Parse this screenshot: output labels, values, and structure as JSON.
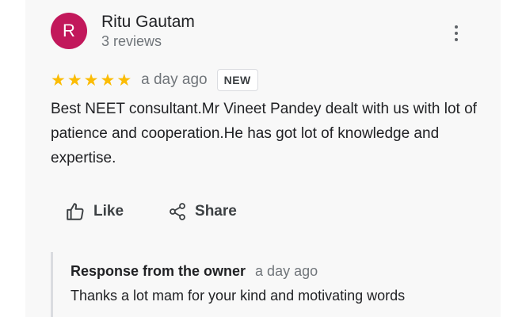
{
  "reviewer": {
    "initial": "R",
    "name": "Ritu Gautam",
    "reviews_count": "3 reviews",
    "avatar_color": "#c2185b"
  },
  "review": {
    "rating": 5,
    "max_rating": 5,
    "star_color": "#fbbc04",
    "time": "a day ago",
    "badge": "NEW",
    "text": "Best NEET consultant.Mr Vineet Pandey dealt with us with lot of patience and cooperation.He has got lot of knowledge and expertise."
  },
  "actions": {
    "like_label": "Like",
    "like_icon": "thumbs-up-icon",
    "share_label": "Share",
    "share_icon": "share-icon"
  },
  "owner_response": {
    "title": "Response from the owner",
    "time": "a day ago",
    "text": "Thanks a lot mam for your kind and motivating words"
  }
}
